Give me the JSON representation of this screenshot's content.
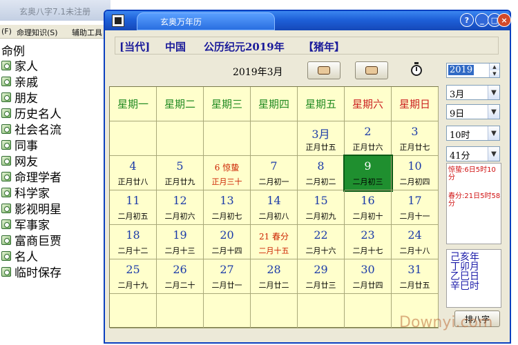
{
  "background_window": {
    "title": "玄奥八字7.1未注册",
    "menu": [
      "(F)",
      "命理知识(S)",
      "辅助工具"
    ],
    "tree_root": "命例",
    "tree_items": [
      "家人",
      "亲戚",
      "朋友",
      "历史名人",
      "社会名流",
      "同事",
      "网友",
      "命理学者",
      "科学家",
      "影视明星",
      "军事家",
      "富商巨贾",
      "名人",
      "临时保存"
    ]
  },
  "dialog": {
    "title": "玄奥万年历",
    "info": {
      "era": "[当代]",
      "country": "中国",
      "calendar": "公历纪元2019年",
      "zodiac": "【猪年】"
    },
    "month_label": "2019年3月",
    "weekdays": [
      "星期一",
      "星期二",
      "星期三",
      "星期四",
      "星期五",
      "星期六",
      "星期日"
    ],
    "weeks": [
      [
        null,
        null,
        null,
        null,
        {
          "d": "3月",
          "l": "正月廿五"
        },
        {
          "d": "2",
          "l": "正月廿六"
        },
        {
          "d": "3",
          "l": "正月廿七"
        }
      ],
      [
        {
          "d": "4",
          "l": "正月廿八"
        },
        {
          "d": "5",
          "l": "正月廿九"
        },
        {
          "d": "6 惊蛰",
          "l": "正月三十",
          "holiday": true
        },
        {
          "d": "7",
          "l": "二月初一"
        },
        {
          "d": "8",
          "l": "二月初二"
        },
        {
          "d": "9",
          "l": "二月初三",
          "selected": true
        },
        {
          "d": "10",
          "l": "二月初四"
        }
      ],
      [
        {
          "d": "11",
          "l": "二月初五"
        },
        {
          "d": "12",
          "l": "二月初六"
        },
        {
          "d": "13",
          "l": "二月初七"
        },
        {
          "d": "14",
          "l": "二月初八"
        },
        {
          "d": "15",
          "l": "二月初九"
        },
        {
          "d": "16",
          "l": "二月初十"
        },
        {
          "d": "17",
          "l": "二月十一"
        }
      ],
      [
        {
          "d": "18",
          "l": "二月十二"
        },
        {
          "d": "19",
          "l": "二月十三"
        },
        {
          "d": "20",
          "l": "二月十四"
        },
        {
          "d": "21 春分",
          "l": "二月十五",
          "holiday": true
        },
        {
          "d": "22",
          "l": "二月十六"
        },
        {
          "d": "23",
          "l": "二月十七"
        },
        {
          "d": "24",
          "l": "二月十八"
        }
      ],
      [
        {
          "d": "25",
          "l": "二月十九"
        },
        {
          "d": "26",
          "l": "二月二十"
        },
        {
          "d": "27",
          "l": "二月廿一"
        },
        {
          "d": "28",
          "l": "二月廿二"
        },
        {
          "d": "29",
          "l": "二月廿三"
        },
        {
          "d": "30",
          "l": "二月廿四"
        },
        {
          "d": "31",
          "l": "二月廿五"
        }
      ],
      [
        null,
        null,
        null,
        null,
        null,
        null,
        null
      ]
    ],
    "controls": {
      "year": "2019",
      "month": "3月",
      "day": "9日",
      "hour": "10时",
      "minute": "41分"
    },
    "solar_terms": [
      "惊蛰:6日5时10分",
      "春分:21日5时58分"
    ],
    "bazi": [
      "己亥年",
      "丁卯月",
      "乙巳日",
      "辛巳时"
    ],
    "bazi_button": "排八字"
  },
  "watermark": "Downyi.com",
  "colors": {
    "title_blue": "#1e60d8",
    "grid_bg": "#ffffcc",
    "weekday_green": "#228b22",
    "weekend_red": "#cc2222",
    "selected_green": "#1f8f2f"
  }
}
